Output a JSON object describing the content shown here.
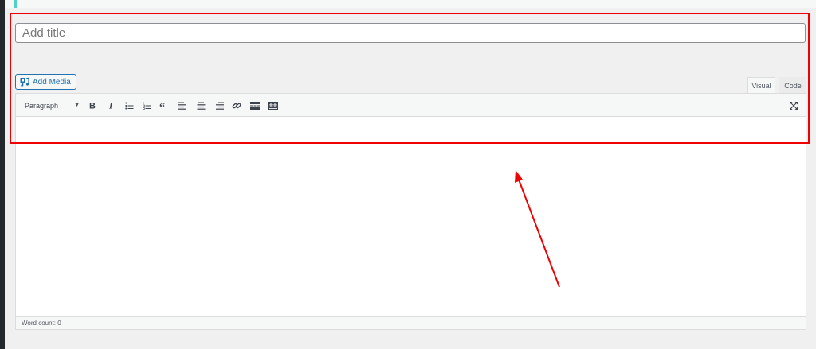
{
  "title_field": {
    "placeholder": "Add title",
    "value": ""
  },
  "media": {
    "add_media_label": "Add Media"
  },
  "tabs": {
    "visual": "Visual",
    "code": "Code"
  },
  "toolbar": {
    "format_select": "Paragraph",
    "buttons": [
      {
        "name": "bold",
        "icon": "bold-icon"
      },
      {
        "name": "italic",
        "icon": "italic-icon"
      },
      {
        "name": "bulleted-list",
        "icon": "bulleted-list-icon"
      },
      {
        "name": "numbered-list",
        "icon": "numbered-list-icon"
      },
      {
        "name": "blockquote",
        "icon": "blockquote-icon"
      },
      {
        "name": "align-left",
        "icon": "align-left-icon"
      },
      {
        "name": "align-center",
        "icon": "align-center-icon"
      },
      {
        "name": "align-right",
        "icon": "align-right-icon"
      },
      {
        "name": "insert-link",
        "icon": "link-icon"
      },
      {
        "name": "read-more",
        "icon": "read-more-icon"
      },
      {
        "name": "toolbar-toggle",
        "icon": "keyboard-icon"
      },
      {
        "name": "fullscreen",
        "icon": "fullscreen-icon"
      }
    ]
  },
  "status": {
    "word_count": "Word count: 0"
  },
  "colors": {
    "accent": "#2271b1",
    "annotation": "#ee0000",
    "left_accent": "#4fd1c5"
  }
}
